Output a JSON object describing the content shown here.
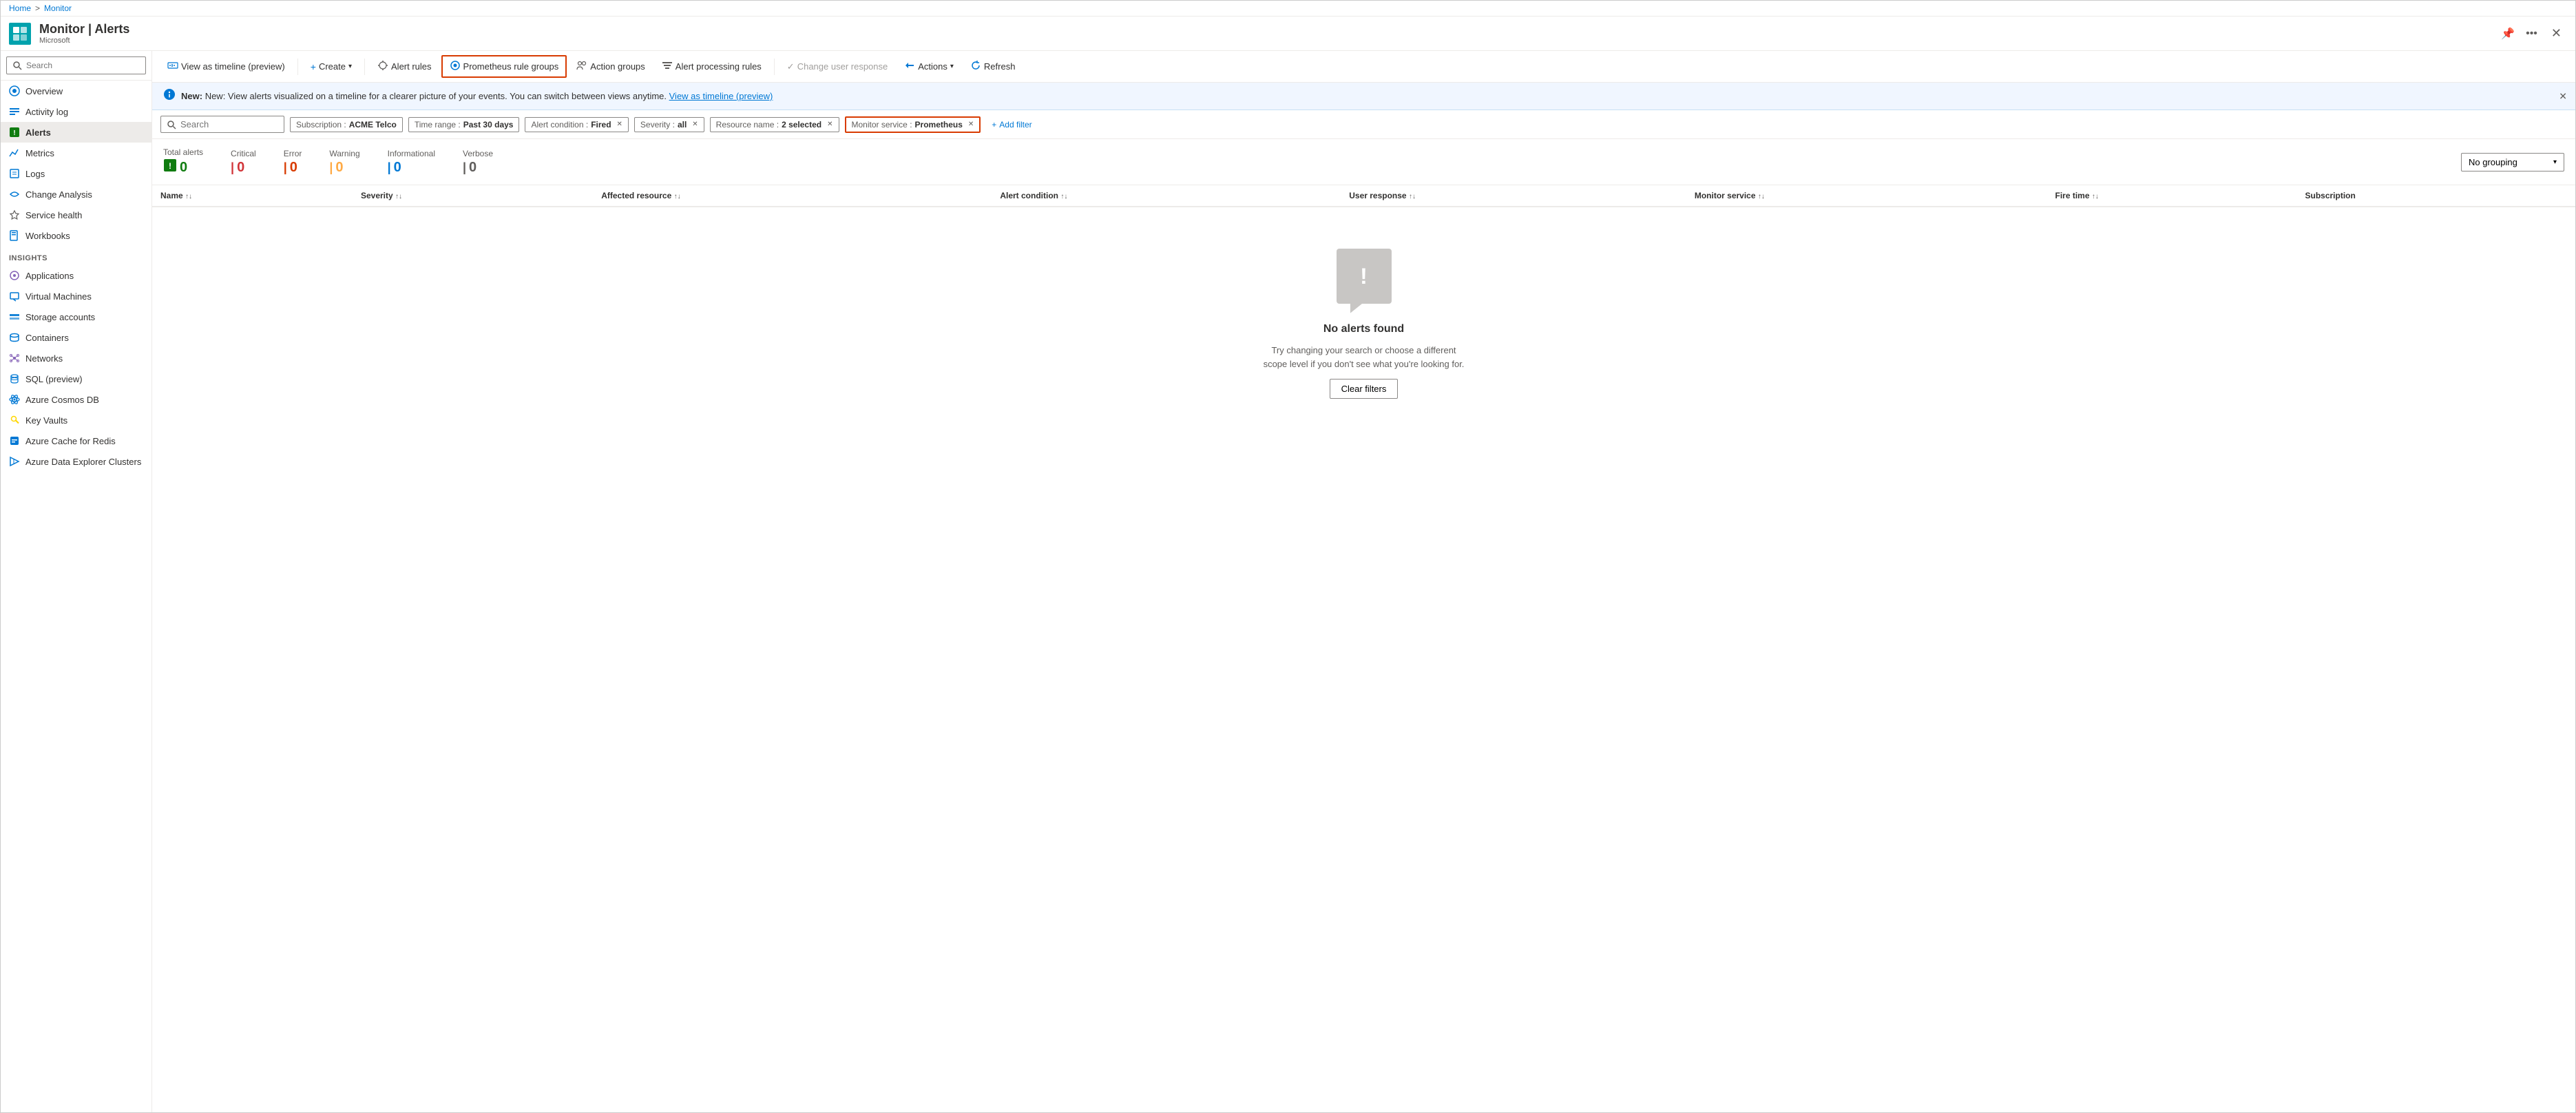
{
  "breadcrumb": {
    "home": "Home",
    "separator": ">",
    "current": "Monitor"
  },
  "header": {
    "icon_text": "M",
    "title": "Monitor | Alerts",
    "subtitle": "Microsoft",
    "pin_tooltip": "Pin",
    "more_tooltip": "More"
  },
  "toolbar": {
    "view_timeline": "View as timeline (preview)",
    "create": "Create",
    "alert_rules": "Alert rules",
    "prometheus_rule_groups": "Prometheus rule groups",
    "action_groups": "Action groups",
    "alert_processing_rules": "Alert processing rules",
    "change_user_response": "Change user response",
    "actions": "Actions",
    "refresh": "Refresh"
  },
  "notification": {
    "text": "New: View alerts visualized on a timeline for a clearer picture of your events. You can switch between views anytime.",
    "link_text": "View as timeline (preview)"
  },
  "filters": {
    "search_placeholder": "Search",
    "subscription_label": "Subscription :",
    "subscription_value": "ACME Telco",
    "time_range_label": "Time range :",
    "time_range_value": "Past 30 days",
    "alert_condition_label": "Alert condition :",
    "alert_condition_value": "Fired",
    "severity_label": "Severity :",
    "severity_value": "all",
    "resource_name_label": "Resource name :",
    "resource_name_value": "2 selected",
    "monitor_service_label": "Monitor service :",
    "monitor_service_value": "Prometheus",
    "add_filter": "Add filter"
  },
  "stats": {
    "total_alerts_label": "Total alerts",
    "total_alerts_value": "0",
    "critical_label": "Critical",
    "critical_value": "0",
    "error_label": "Error",
    "error_value": "0",
    "warning_label": "Warning",
    "warning_value": "0",
    "informational_label": "Informational",
    "informational_value": "0",
    "verbose_label": "Verbose",
    "verbose_value": "0",
    "grouping_label": "No grouping"
  },
  "table": {
    "columns": [
      {
        "label": "Name",
        "sort": true
      },
      {
        "label": "Severity",
        "sort": true
      },
      {
        "label": "Affected resource",
        "sort": true
      },
      {
        "label": "Alert condition",
        "sort": true
      },
      {
        "label": "User response",
        "sort": true
      },
      {
        "label": "Monitor service",
        "sort": true
      },
      {
        "label": "Fire time",
        "sort": true
      },
      {
        "label": "Subscription",
        "sort": false
      }
    ],
    "rows": []
  },
  "empty_state": {
    "title": "No alerts found",
    "description": "Try changing your search or choose a different scope level if you don't see what you're looking for.",
    "clear_filters": "Clear filters"
  },
  "sidebar": {
    "search_placeholder": "Search",
    "nav_items": [
      {
        "label": "Overview",
        "icon": "overview",
        "active": false
      },
      {
        "label": "Activity log",
        "icon": "activity",
        "active": false
      },
      {
        "label": "Alerts",
        "icon": "alerts",
        "active": true
      },
      {
        "label": "Metrics",
        "icon": "metrics",
        "active": false
      },
      {
        "label": "Logs",
        "icon": "logs",
        "active": false
      },
      {
        "label": "Change Analysis",
        "icon": "change",
        "active": false
      },
      {
        "label": "Service health",
        "icon": "service-health",
        "active": false
      },
      {
        "label": "Workbooks",
        "icon": "workbooks",
        "active": false
      }
    ],
    "insights_label": "Insights",
    "insights_items": [
      {
        "label": "Applications",
        "icon": "applications"
      },
      {
        "label": "Virtual Machines",
        "icon": "vms"
      },
      {
        "label": "Storage accounts",
        "icon": "storage"
      },
      {
        "label": "Containers",
        "icon": "containers"
      },
      {
        "label": "Networks",
        "icon": "networks"
      },
      {
        "label": "SQL (preview)",
        "icon": "sql"
      },
      {
        "label": "Azure Cosmos DB",
        "icon": "cosmos"
      },
      {
        "label": "Key Vaults",
        "icon": "keyvaults"
      },
      {
        "label": "Azure Cache for Redis",
        "icon": "redis"
      },
      {
        "label": "Azure Data Explorer Clusters",
        "icon": "dataexplorer"
      }
    ]
  },
  "colors": {
    "accent_blue": "#0078d4",
    "critical_red": "#d13438",
    "error_orange": "#d83b01",
    "warning_yellow": "#ffaa44",
    "info_blue": "#0078d4",
    "verbose_gray": "#605e5c",
    "total_green": "#107c10",
    "prometheus_border": "#d83b01"
  }
}
